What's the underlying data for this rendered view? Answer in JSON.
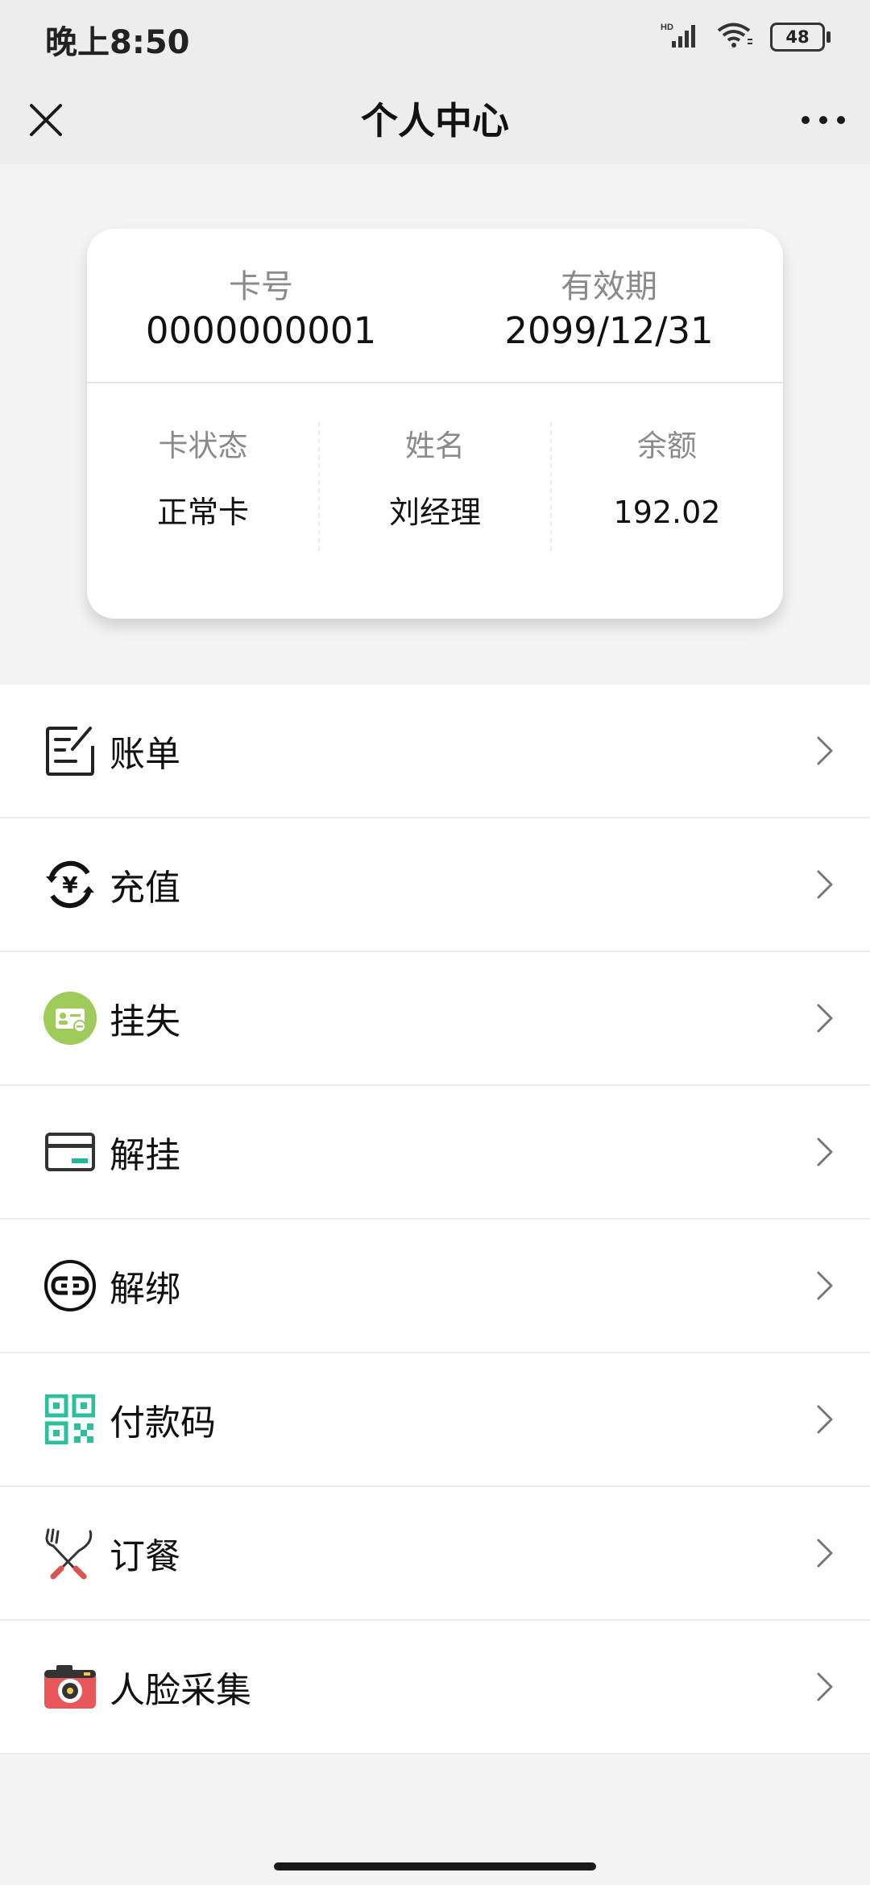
{
  "status_bar": {
    "time": "晚上8:50",
    "battery": "48",
    "network_label": "HD",
    "icons": [
      "signal-icon",
      "wifi-icon",
      "battery-icon"
    ]
  },
  "nav": {
    "title": "个人中心",
    "close_icon": "close-icon",
    "more_icon": "more-icon"
  },
  "card": {
    "card_number_label": "卡号",
    "card_number": "0000000001",
    "expiry_label": "有效期",
    "expiry": "2099/12/31",
    "status_label": "卡状态",
    "status": "正常卡",
    "name_label": "姓名",
    "name": "刘经理",
    "balance_label": "余额",
    "balance": "192.02"
  },
  "menu": {
    "items": [
      {
        "label": "账单",
        "icon": "bill-icon"
      },
      {
        "label": "充值",
        "icon": "recharge-icon"
      },
      {
        "label": "挂失",
        "icon": "report-loss-icon"
      },
      {
        "label": "解挂",
        "icon": "unreport-icon"
      },
      {
        "label": "解绑",
        "icon": "unbind-icon"
      },
      {
        "label": "付款码",
        "icon": "qr-code-icon"
      },
      {
        "label": "订餐",
        "icon": "meal-order-icon"
      },
      {
        "label": "人脸采集",
        "icon": "camera-icon"
      }
    ]
  },
  "colors": {
    "header_bg": "#ededed",
    "page_bg": "#f4f4f4",
    "card_bg": "#ffffff",
    "label_gray": "#8a8a8a",
    "loss_green": "#9ecb5a",
    "teal": "#2bbf9b",
    "camera_red": "#e8585a",
    "utensil_red": "#d9534f"
  }
}
